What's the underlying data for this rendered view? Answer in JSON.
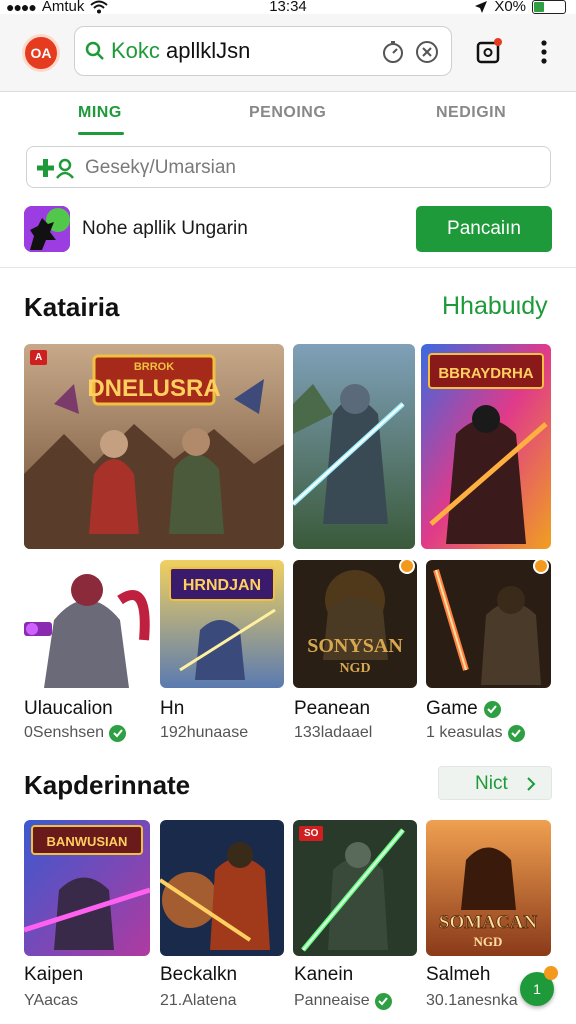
{
  "status_bar": {
    "carrier": "Amtuk",
    "time": "13:34",
    "battery": "X0%",
    "battery_level": 0.35
  },
  "browser": {
    "logo_text": "OA",
    "url_prefix": "Kokc",
    "url_text": "apllklJsn"
  },
  "tabs": [
    {
      "label": "MING",
      "active": true
    },
    {
      "label": "PENOING",
      "active": false
    },
    {
      "label": "NEDIGIN",
      "active": false
    }
  ],
  "search": {
    "placeholder": "Gesekγ/Umarsian"
  },
  "app_row": {
    "title": "Nohe apllik Ungarin",
    "button_label": "Pancaiın"
  },
  "section1": {
    "title": "Katairia",
    "link": "Hhabuιdy",
    "featured_tiles": [
      {
        "art": "banner",
        "banner_text": "DNELUSRA",
        "banner_top": "BRROK",
        "badge": "A"
      },
      {
        "art": "knight-blue"
      },
      {
        "art": "hero-red",
        "banner_text": "BBRAYDRHA"
      }
    ],
    "games": [
      {
        "name": "Ulaucalion",
        "sub": "0Senshsen",
        "verified": true,
        "art": "armor-red"
      },
      {
        "name": "Hn",
        "sub": "192hunaase",
        "verified": false,
        "art": "warrior-banner",
        "banner_text": "HRNDJAN"
      },
      {
        "name": "Peanean",
        "sub": "133ladaael",
        "verified": false,
        "art": "dark-text",
        "banner_text": "SONYSAN",
        "banner_sub": "NGD",
        "badge": true
      },
      {
        "name": "Game",
        "sub": "1 keasulas",
        "verified": true,
        "name_check": true,
        "art": "dark-fire",
        "badge": true
      }
    ]
  },
  "section2": {
    "title": "Kapderinnate",
    "link": "Nict",
    "games": [
      {
        "name": "Kaipen",
        "sub": "YAacas",
        "verified": false,
        "art": "pink-laser",
        "banner_text": "BANWUSIAN"
      },
      {
        "name": "Beckalkn",
        "sub": "21.Alatena",
        "verified": false,
        "art": "fire-hat"
      },
      {
        "name": "Kanein",
        "sub": "Panneaise",
        "verified": true,
        "art": "green-knight",
        "badge": "SO"
      },
      {
        "name": "Salmeh",
        "sub": "30.1anesnka",
        "verified": false,
        "art": "orange-text",
        "banner_text": "SOMACAN",
        "banner_sub": "NGD",
        "badge": true
      }
    ]
  },
  "fab_label": "1",
  "colors": {
    "accent": "#1e9a3a",
    "brand": "#e53b1e",
    "badge": "#f39a1e"
  }
}
